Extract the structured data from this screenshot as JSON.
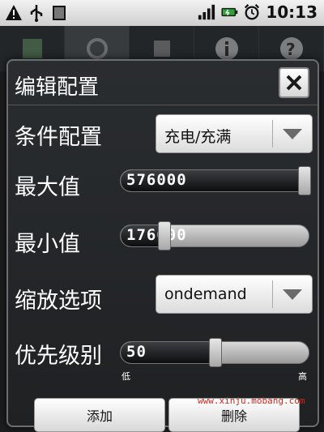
{
  "status_bar": {
    "time": "10:13"
  },
  "dialog": {
    "title": "编辑配置",
    "rows": {
      "condition": {
        "label": "条件配置",
        "value": "充电/充满"
      },
      "max": {
        "label": "最大值",
        "value": "576000",
        "level_fraction": 1.0
      },
      "min": {
        "label": "最小值",
        "value": "176000",
        "level_fraction": 0.23
      },
      "governor": {
        "label": "缩放选项",
        "value": "ondemand"
      },
      "priority": {
        "label": "优先级别",
        "value": "50",
        "level_fraction": 0.5,
        "low_label": "低",
        "high_label": "高"
      }
    },
    "buttons": {
      "left": "添加",
      "right": "删除"
    }
  },
  "watermark": "www.xinju.mobang.com"
}
